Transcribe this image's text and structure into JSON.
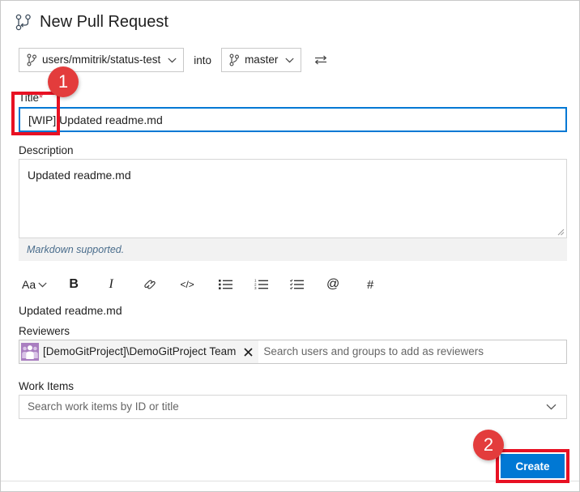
{
  "header": {
    "title": "New Pull Request",
    "icon": "pull-request-icon"
  },
  "branch_row": {
    "source_branch": "users/mmitrik/status-test",
    "into_label": "into",
    "target_branch": "master",
    "swap_icon": "swap-branches-icon",
    "branch_icon": "branch-icon",
    "chevron_icon": "chevron-down-icon"
  },
  "form": {
    "title_label": "Title",
    "title_required_mark": "*",
    "title_value": "[WIP] Updated readme.md",
    "description_label": "Description",
    "description_value": "Updated readme.md",
    "markdown_note": "Markdown supported.",
    "description_preview": "Updated readme.md"
  },
  "toolbar": {
    "font_size_label": "Aa",
    "bold_label": "B",
    "italic_label": "I",
    "link_icon": "link-icon",
    "code_label": "</>",
    "bulleted_list_icon": "bulleted-list-icon",
    "numbered_list_icon": "numbered-list-icon",
    "task_list_icon": "task-list-icon",
    "mention_label": "@",
    "hashtag_label": "#"
  },
  "reviewers": {
    "label": "Reviewers",
    "chip_name": "[DemoGitProject]\\DemoGitProject Team",
    "chip_avatar_icon": "team-group-icon",
    "chip_remove_icon": "close-icon",
    "placeholder": "Search users and groups to add as reviewers"
  },
  "work_items": {
    "label": "Work Items",
    "placeholder": "Search work items by ID or title",
    "chevron_icon": "chevron-down-icon"
  },
  "footer": {
    "create_label": "Create"
  },
  "annotations": {
    "badge_one": "1",
    "badge_two": "2",
    "highlight_color": "#e81123",
    "badge_color": "#e33c3c"
  },
  "colors": {
    "accent_blue": "#0078d4",
    "focus_border": "#0078d4",
    "avatar_purple": "#a97ec0",
    "required_red": "#cc293d"
  }
}
